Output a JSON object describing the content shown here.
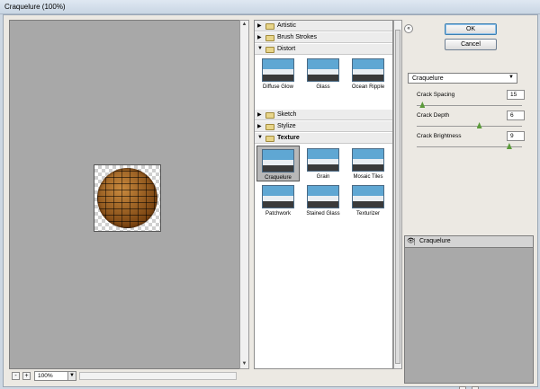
{
  "window": {
    "title": "Craquelure (100%)"
  },
  "preview": {
    "zoom": "100%",
    "zoom_in_label": "+",
    "zoom_out_label": "-"
  },
  "gallery": {
    "categories": [
      {
        "label": "Artistic",
        "expanded": false
      },
      {
        "label": "Brush Strokes",
        "expanded": false
      },
      {
        "label": "Distort",
        "expanded": true
      },
      {
        "label": "Sketch",
        "expanded": false
      },
      {
        "label": "Stylize",
        "expanded": false
      },
      {
        "label": "Texture",
        "expanded": true
      }
    ],
    "distort": [
      "Diffuse Glow",
      "Glass",
      "Ocean Ripple"
    ],
    "texture": [
      "Craquelure",
      "Grain",
      "Mosaic Tiles",
      "Patchwork",
      "Stained Glass",
      "Texturizer"
    ],
    "selected": "Craquelure"
  },
  "buttons": {
    "ok": "OK",
    "cancel": "Cancel"
  },
  "filter_select": {
    "value": "Craquelure"
  },
  "params": [
    {
      "label": "Crack Spacing",
      "value": "15",
      "fraction": 0.03
    },
    {
      "label": "Crack Depth",
      "value": "6",
      "fraction": 0.6
    },
    {
      "label": "Crack Brightness",
      "value": "9",
      "fraction": 0.9
    }
  ],
  "layers": {
    "items": [
      "Craquelure"
    ]
  },
  "colors": {
    "accent": "#3c7fb1",
    "slider": "#5b9a3a",
    "preview_bg": "#a8a8a8"
  }
}
